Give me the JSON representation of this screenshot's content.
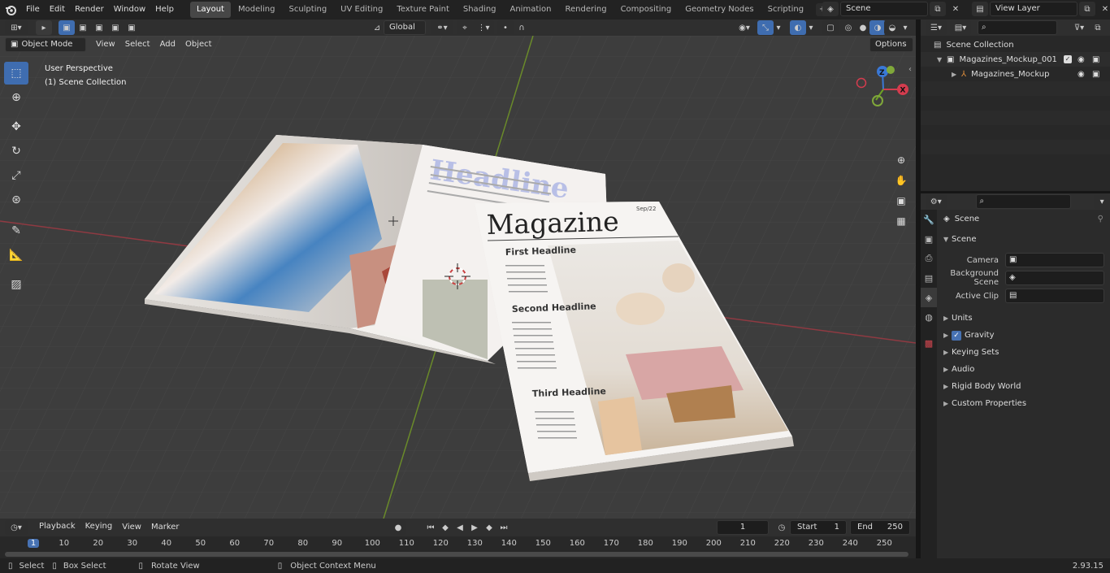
{
  "top_menu": [
    "File",
    "Edit",
    "Render",
    "Window",
    "Help"
  ],
  "workspaces": [
    "Layout",
    "Modeling",
    "Sculpting",
    "UV Editing",
    "Texture Paint",
    "Shading",
    "Animation",
    "Rendering",
    "Compositing",
    "Geometry Nodes",
    "Scripting"
  ],
  "active_workspace": "Layout",
  "scene_field": "Scene",
  "view_layer_field": "View Layer",
  "viewport_header": {
    "mode": "Object Mode",
    "menus": [
      "View",
      "Select",
      "Add",
      "Object"
    ],
    "transform_orientation": "Global",
    "options_label": "Options"
  },
  "viewport_info": {
    "line1": "User Perspective",
    "line2": "(1) Scene Collection"
  },
  "gizmo_axes": {
    "z": "Z",
    "x": "X"
  },
  "magazine": {
    "headline_left": "Headline",
    "cover_title": "Magazine",
    "issue": "Sep/22",
    "first": "First Headline",
    "second": "Second Headline",
    "third": "Third Headline"
  },
  "outliner": {
    "root": "Scene Collection",
    "collection": "Magazines_Mockup_001",
    "object": "Magazines_Mockup"
  },
  "properties": {
    "context_label": "Scene",
    "section": "Scene",
    "fields": [
      {
        "label": "Camera"
      },
      {
        "label": "Background Scene"
      },
      {
        "label": "Active Clip"
      }
    ],
    "panels": [
      "Units",
      "Gravity",
      "Keying Sets",
      "Audio",
      "Rigid Body World",
      "Custom Properties"
    ]
  },
  "timeline": {
    "menus": [
      "Playback",
      "Keying",
      "View",
      "Marker"
    ],
    "current_frame": "1",
    "start_label": "Start",
    "start_value": "1",
    "end_label": "End",
    "end_value": "250",
    "ticks": [
      "1",
      "10",
      "20",
      "30",
      "40",
      "50",
      "60",
      "70",
      "80",
      "90",
      "100",
      "110",
      "120",
      "130",
      "140",
      "150",
      "160",
      "170",
      "180",
      "190",
      "200",
      "210",
      "220",
      "230",
      "240",
      "250"
    ]
  },
  "status_bar": {
    "select": "Select",
    "box_select": "Box Select",
    "rotate_view": "Rotate View",
    "context_menu": "Object Context Menu",
    "version": "2.93.15"
  },
  "colors": {
    "accent_blue": "#3f6db0",
    "axis_red": "#a8353f",
    "axis_green": "#6ea224",
    "active_frame": "#4772b3"
  }
}
